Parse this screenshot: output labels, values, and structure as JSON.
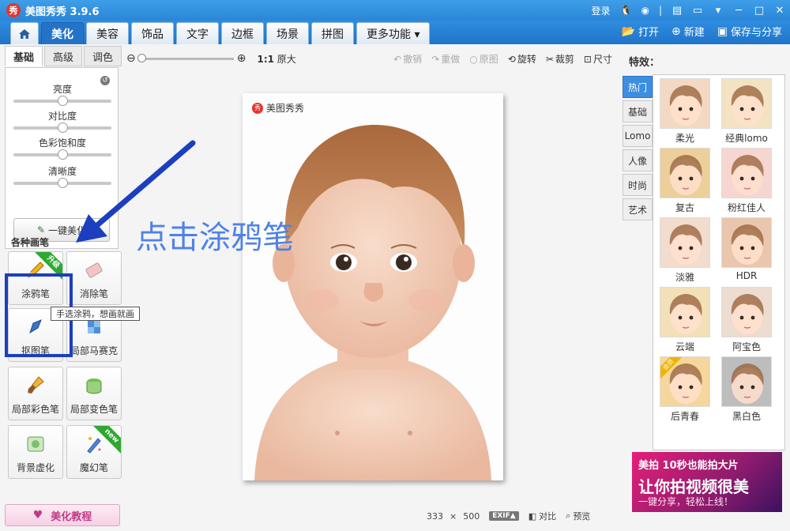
{
  "app": {
    "logo_char": "秀",
    "title": "美图秀秀 3.9.6"
  },
  "titlebar": {
    "login": "登录"
  },
  "nav": {
    "tabs": [
      "美化",
      "美容",
      "饰品",
      "文字",
      "边框",
      "场景",
      "拼图",
      "更多功能 ▾"
    ],
    "active_tab": "美化",
    "open": "打开",
    "new": "新建",
    "save_share": "保存与分享"
  },
  "left": {
    "subtabs": [
      "基础",
      "高级",
      "调色"
    ],
    "adjust": [
      {
        "label": "亮度",
        "value": 0.5
      },
      {
        "label": "对比度",
        "value": 0.5
      },
      {
        "label": "色彩饱和度",
        "value": 0.5
      },
      {
        "label": "清晰度",
        "value": 0.5
      }
    ],
    "one_key": "一键美化",
    "brush_title": "各种画笔",
    "brushes": [
      {
        "label": "涂鸦笔",
        "badge": "升级"
      },
      {
        "label": "消除笔",
        "badge": ""
      },
      {
        "label": "抠图笔",
        "badge": ""
      },
      {
        "label": "局部马赛克",
        "badge": ""
      },
      {
        "label": "局部彩色笔",
        "badge": ""
      },
      {
        "label": "局部变色笔",
        "badge": ""
      },
      {
        "label": "背景虚化",
        "badge": ""
      },
      {
        "label": "魔幻笔",
        "badge": "new"
      }
    ],
    "tooltip": "手选涂鸦，想画就画",
    "tutorial": "美化教程"
  },
  "toolbar": {
    "ratio": "1:1",
    "original_size": "原大",
    "undo": "撤销",
    "redo": "重做",
    "original": "原图",
    "rotate": "旋转",
    "crop": "裁剪",
    "size": "尺寸"
  },
  "canvas": {
    "watermark": "美图秀秀",
    "annotation": "点击涂鸦笔"
  },
  "status": {
    "width": "333",
    "times": "×",
    "height": "500",
    "exif": "EXIF▲",
    "compare": "对比",
    "preview": "预览"
  },
  "right": {
    "title": "特效：",
    "vtabs": [
      "热门",
      "基础",
      "Lomo",
      "人像",
      "时尚",
      "艺术"
    ],
    "effects": [
      {
        "label": "柔光",
        "tone": "#f3d9c4"
      },
      {
        "label": "经典lomo",
        "tone": "#f4e3c3"
      },
      {
        "label": "复古",
        "tone": "#eccf9a"
      },
      {
        "label": "粉红佳人",
        "tone": "#f6d6d0"
      },
      {
        "label": "淡雅",
        "tone": "#f1dccd"
      },
      {
        "label": "HDR",
        "tone": "#e9c6ad"
      },
      {
        "label": "云端",
        "tone": "#f2e0b8"
      },
      {
        "label": "阿宝色",
        "tone": "#eddcd0"
      },
      {
        "label": "后青春",
        "tone": "#f5d69c",
        "vip": "会员"
      },
      {
        "label": "黑白色",
        "tone": "#bdbdbd"
      }
    ],
    "ad": {
      "line1": "美拍 10秒也能拍大片",
      "line2": "让你拍视频很美",
      "line3": "一键分享，轻松上线！"
    }
  },
  "colors": {
    "accent": "#2573c9",
    "highlight": "#1b3fbf",
    "annotation": "#4f82e8"
  }
}
